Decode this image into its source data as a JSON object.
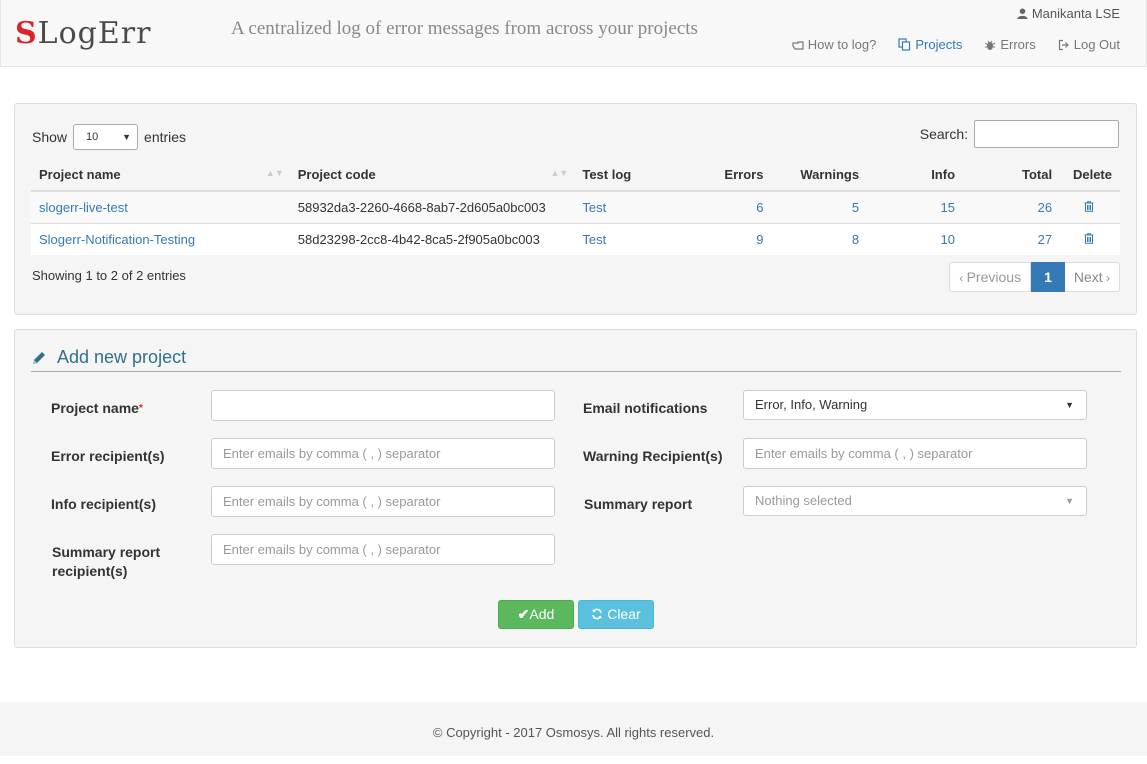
{
  "app": {
    "logo_first": "S",
    "logo_rest": "LogErr",
    "tagline": "A centralized log of error messages from across your projects",
    "user_name": "Manikanta LSE"
  },
  "nav": {
    "how_to_log": "How to log?",
    "projects": "Projects",
    "errors": "Errors",
    "logout": "Log Out"
  },
  "table": {
    "show_label": "Show",
    "entries_label": "entries",
    "page_size": "10",
    "search_label": "Search:",
    "search_value": "",
    "columns": [
      "Project name",
      "Project code",
      "Test log",
      "Errors",
      "Warnings",
      "Info",
      "Total",
      "Delete"
    ],
    "rows": [
      {
        "name": "slogerr-live-test",
        "code": "58932da3-2260-4668-8ab7-2d605a0bc003",
        "test": "Test",
        "errors": "6",
        "warnings": "5",
        "info": "15",
        "total": "26"
      },
      {
        "name": "Slogerr-Notification-Testing",
        "code": "58d23298-2cc8-4b42-8ca5-2f905a0bc003",
        "test": "Test",
        "errors": "9",
        "warnings": "8",
        "info": "10",
        "total": "27"
      }
    ],
    "info_text": "Showing 1 to 2 of 2 entries",
    "prev": "Previous",
    "page": "1",
    "next": "Next"
  },
  "form": {
    "title": "Add new project",
    "project_name_label": "Project name",
    "required_mark": "*",
    "project_name_value": "",
    "email_notifications_label": "Email notifications",
    "email_notifications_value": "Error, Info, Warning",
    "error_recipients_label": "Error recipient(s)",
    "warning_recipients_label": "Warning Recipient(s)",
    "info_recipients_label": "Info recipient(s)",
    "summary_report_label": "Summary report",
    "summary_report_value": "Nothing selected",
    "summary_recipients_label_1": "Summary report",
    "summary_recipients_label_2": "recipient(s)",
    "email_placeholder": "Enter emails by comma ( , ) separator",
    "add_label": "Add",
    "clear_label": "Clear"
  },
  "footer": {
    "copyright": "© Copyright - 2017 Osmosys. All rights reserved."
  },
  "colors": {
    "brand_red": "#d9252a",
    "link": "#337ab7",
    "success": "#5cb85c",
    "info": "#5bc0de"
  }
}
